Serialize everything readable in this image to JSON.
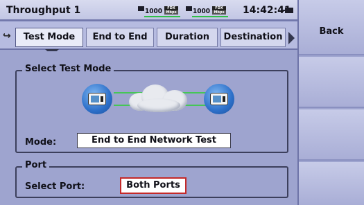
{
  "status": {
    "title": "Throughput 1",
    "port1": {
      "speed": "1000",
      "duplex_top": "FDX",
      "duplex_bottom": "Mbps"
    },
    "port2": {
      "speed": "1000",
      "duplex_top": "FDX",
      "duplex_bottom": "Mbps"
    },
    "time": "14:42:41",
    "link_color": "#30c048"
  },
  "tabs": [
    {
      "label": "Test Mode",
      "active": true
    },
    {
      "label": "End to End"
    },
    {
      "label": "Duration"
    },
    {
      "label": "Destination"
    }
  ],
  "test_mode": {
    "legend": "Select Test Mode",
    "mode_label": "Mode:",
    "mode_value": "End to End Network Test"
  },
  "port": {
    "legend": "Port",
    "select_label": "Select Port:",
    "select_value": "Both Ports",
    "highlight_color": "#c42929"
  },
  "softkeys": {
    "back": "Back"
  },
  "icons": [
    "scroll-left-icon",
    "scroll-right-icon",
    "plug-icon",
    "battery-icon",
    "device-icon",
    "cloud-icon"
  ]
}
